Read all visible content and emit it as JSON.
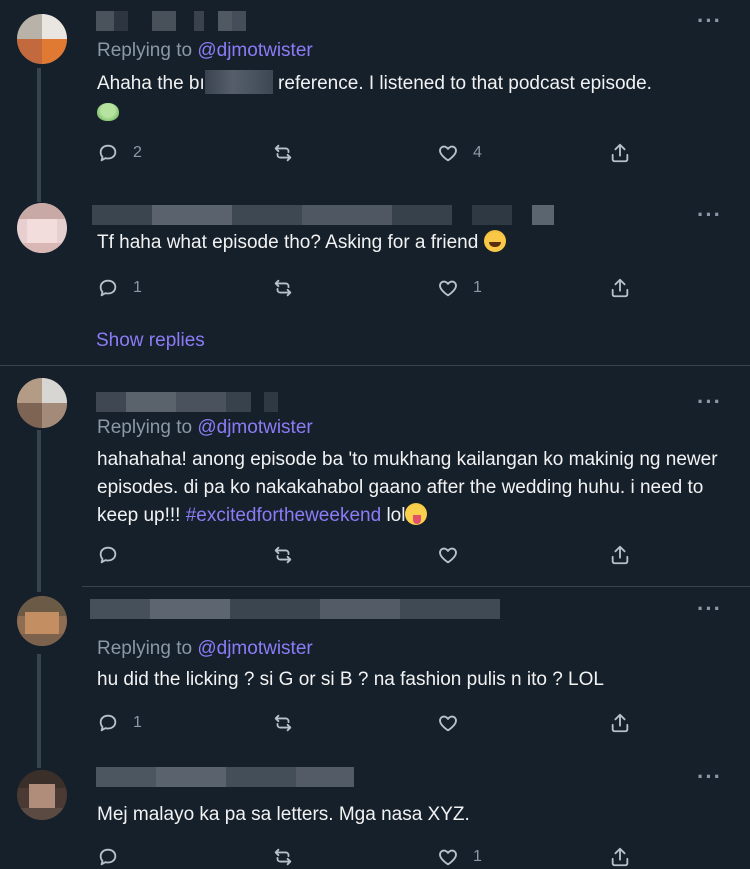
{
  "tweets": [
    {
      "replying_label": "Replying to",
      "handle": "@djmotwister",
      "text_a": "Ahaha the bı",
      "text_b": "reference. I listened to that podcast episode.",
      "replies": "2",
      "retweets": "",
      "likes": "4"
    },
    {
      "text": "Tf haha what episode tho? Asking for a friend",
      "replies": "1",
      "retweets": "",
      "likes": "1",
      "show_replies": "Show replies"
    },
    {
      "replying_label": "Replying to",
      "handle": "@djmotwister",
      "text": "hahahaha! anong episode ba 'to mukhang kailangan ko makinig ng newer episodes. di pa ko nakakahabol gaano after the wedding huhu. i need to keep up!!!",
      "hashtag": "#excitedfortheweekend",
      "text_end": "lol",
      "replies": "",
      "retweets": "",
      "likes": ""
    },
    {
      "replying_label": "Replying to",
      "handle": "@djmotwister",
      "text": "hu did the licking ? si G or si B ? na fashion pulis n ito ? LOL",
      "replies": "1",
      "retweets": "",
      "likes": ""
    },
    {
      "text": "Mej malayo ka pa sa letters. Mga nasa XYZ.",
      "replies": "",
      "retweets": "",
      "likes": "1"
    }
  ],
  "icons": {
    "more": "more-icon",
    "reply": "reply-icon",
    "retweet": "retweet-icon",
    "like": "heart-icon",
    "share": "share-icon"
  },
  "colors": {
    "background": "#15202b",
    "accent": "#8b7cf6",
    "muted": "#8b98a5",
    "divider": "#38444d"
  }
}
